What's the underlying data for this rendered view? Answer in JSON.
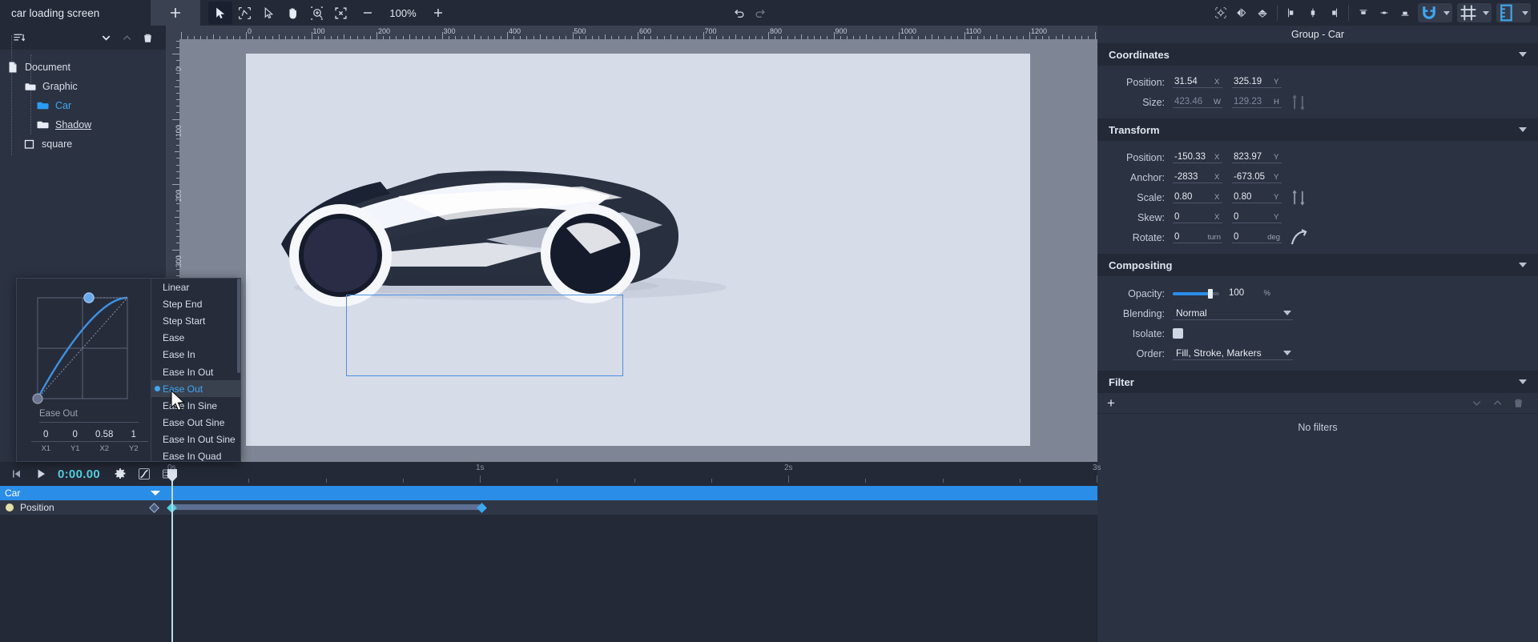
{
  "topbar": {
    "document_title": "car loading screen",
    "add_label": "+",
    "zoom_level": "100%",
    "tools": [
      {
        "name": "select-tool",
        "active": true
      },
      {
        "name": "node-edit-tool",
        "active": false
      },
      {
        "name": "direct-select-tool",
        "active": false
      },
      {
        "name": "pan-tool",
        "active": false
      },
      {
        "name": "zoom-tool",
        "active": false
      },
      {
        "name": "fit-view-tool",
        "active": false
      }
    ],
    "zoom_out_label": "−",
    "zoom_in_label": "+",
    "right_icons": [
      "undo-icon",
      "redo-icon",
      "align-center-icon",
      "magnet-icon",
      "grid-icon",
      "ruler-icon",
      "flip-horizontal-icon",
      "flip-vertical-icon",
      "align-left-icon",
      "align-center-h-icon",
      "align-right-icon",
      "align-top-icon",
      "align-middle-icon",
      "align-bottom-icon"
    ]
  },
  "layers": {
    "toolbar": {
      "sort_icon": "sort-icon",
      "expand_icon": "chevron-down-icon",
      "collapse_icon": "chevron-up-icon",
      "delete_icon": "trash-icon"
    },
    "tree": [
      {
        "label": "Document",
        "depth": 0,
        "icon": "document-icon",
        "style": "plain"
      },
      {
        "label": "Graphic",
        "depth": 1,
        "icon": "folder-open-icon",
        "style": "plain"
      },
      {
        "label": "Car",
        "depth": 2,
        "icon": "folder-icon",
        "style": "selected"
      },
      {
        "label": "Shadow",
        "depth": 2,
        "icon": "folder-icon",
        "style": "underline"
      },
      {
        "label": "square",
        "depth": 1,
        "icon": "square-icon",
        "style": "plain"
      }
    ]
  },
  "easing": {
    "current_name": "Ease Out",
    "values": [
      {
        "key": "X1",
        "value": "0"
      },
      {
        "key": "Y1",
        "value": "0"
      },
      {
        "key": "X2",
        "value": "0.58"
      },
      {
        "key": "Y2",
        "value": "1"
      }
    ],
    "bezier": {
      "x1": 0,
      "y1": 0,
      "x2": 0.58,
      "y2": 1
    },
    "options": [
      "Linear",
      "Step End",
      "Step Start",
      "Ease",
      "Ease In",
      "Ease In Out",
      "Ease Out",
      "Ease In Sine",
      "Ease Out Sine",
      "Ease In Out Sine",
      "Ease In Quad"
    ],
    "selected_option": "Ease Out",
    "curve_color": "#3e8fe0"
  },
  "canvas": {
    "ruler_h_labels": [
      "0",
      "100",
      "200",
      "300",
      "400",
      "500",
      "600",
      "700",
      "800",
      "900",
      "1000",
      "1100",
      "1200"
    ],
    "ruler_v_labels": [
      "0",
      "100",
      "200",
      "300"
    ],
    "selection_color": "#4a90e2",
    "artboard_color": "#d7dce9",
    "background_color": "#7e8696"
  },
  "properties": {
    "title": "Group - Car",
    "sections": {
      "coordinates": {
        "header": "Coordinates",
        "rows": [
          {
            "label": "Position:",
            "x": "31.54",
            "x_unit": "X",
            "y": "325.19",
            "y_unit": "Y",
            "dim": false
          },
          {
            "label": "Size:",
            "x": "423.46",
            "x_unit": "W",
            "y": "129.23",
            "y_unit": "H",
            "dim": true,
            "suffix_icon": "link-ratio-icon"
          }
        ]
      },
      "transform": {
        "header": "Transform",
        "rows": [
          {
            "label": "Position:",
            "x": "-150.33",
            "x_unit": "X",
            "y": "823.97",
            "y_unit": "Y",
            "dim": false
          },
          {
            "label": "Anchor:",
            "x": "-2833",
            "x_unit": "X",
            "y": "-673.05",
            "y_unit": "Y",
            "dim": false
          },
          {
            "label": "Scale:",
            "x": "0.80",
            "x_unit": "X",
            "y": "0.80",
            "y_unit": "Y",
            "dim": false,
            "suffix_icon": "link-ratio-icon"
          },
          {
            "label": "Skew:",
            "x": "0",
            "x_unit": "X",
            "y": "0",
            "y_unit": "Y",
            "dim": false
          },
          {
            "label": "Rotate:",
            "x": "0",
            "x_unit": "turn",
            "y": "0",
            "y_unit": "deg",
            "dim": false,
            "suffix_icon": "rotate-icon"
          }
        ]
      },
      "compositing": {
        "header": "Compositing",
        "opacity_label": "Opacity:",
        "opacity_value": "100",
        "opacity_unit": "%",
        "opacity_percent": 100,
        "blending_label": "Blending:",
        "blending_value": "Normal",
        "isolate_label": "Isolate:",
        "isolate_checked": true,
        "order_label": "Order:",
        "order_value": "Fill, Stroke, Markers"
      },
      "filter": {
        "header": "Filter",
        "add_label": "+",
        "empty_text": "No filters",
        "down_icon": "chevron-down-icon",
        "up_icon": "chevron-up-icon",
        "delete_icon": "trash-icon"
      }
    },
    "accent_color": "#2a8de8"
  },
  "timeline": {
    "controls": {
      "rewind_icon": "skip-start-icon",
      "play_icon": "play-icon",
      "timecode": "0:00.00",
      "settings_icon": "gear-icon",
      "easing_icon": "easing-curve-icon",
      "onion_icon": "keyframe-settings-icon"
    },
    "ruler_labels": [
      "0s",
      "1s",
      "2s",
      "3s"
    ],
    "tracks": [
      {
        "name": "Car",
        "type": "group",
        "color": "#2a8de8"
      },
      {
        "name": "Position",
        "type": "property",
        "keyframes_seconds": [
          0,
          1.05
        ]
      }
    ],
    "playhead_time": "0s"
  }
}
